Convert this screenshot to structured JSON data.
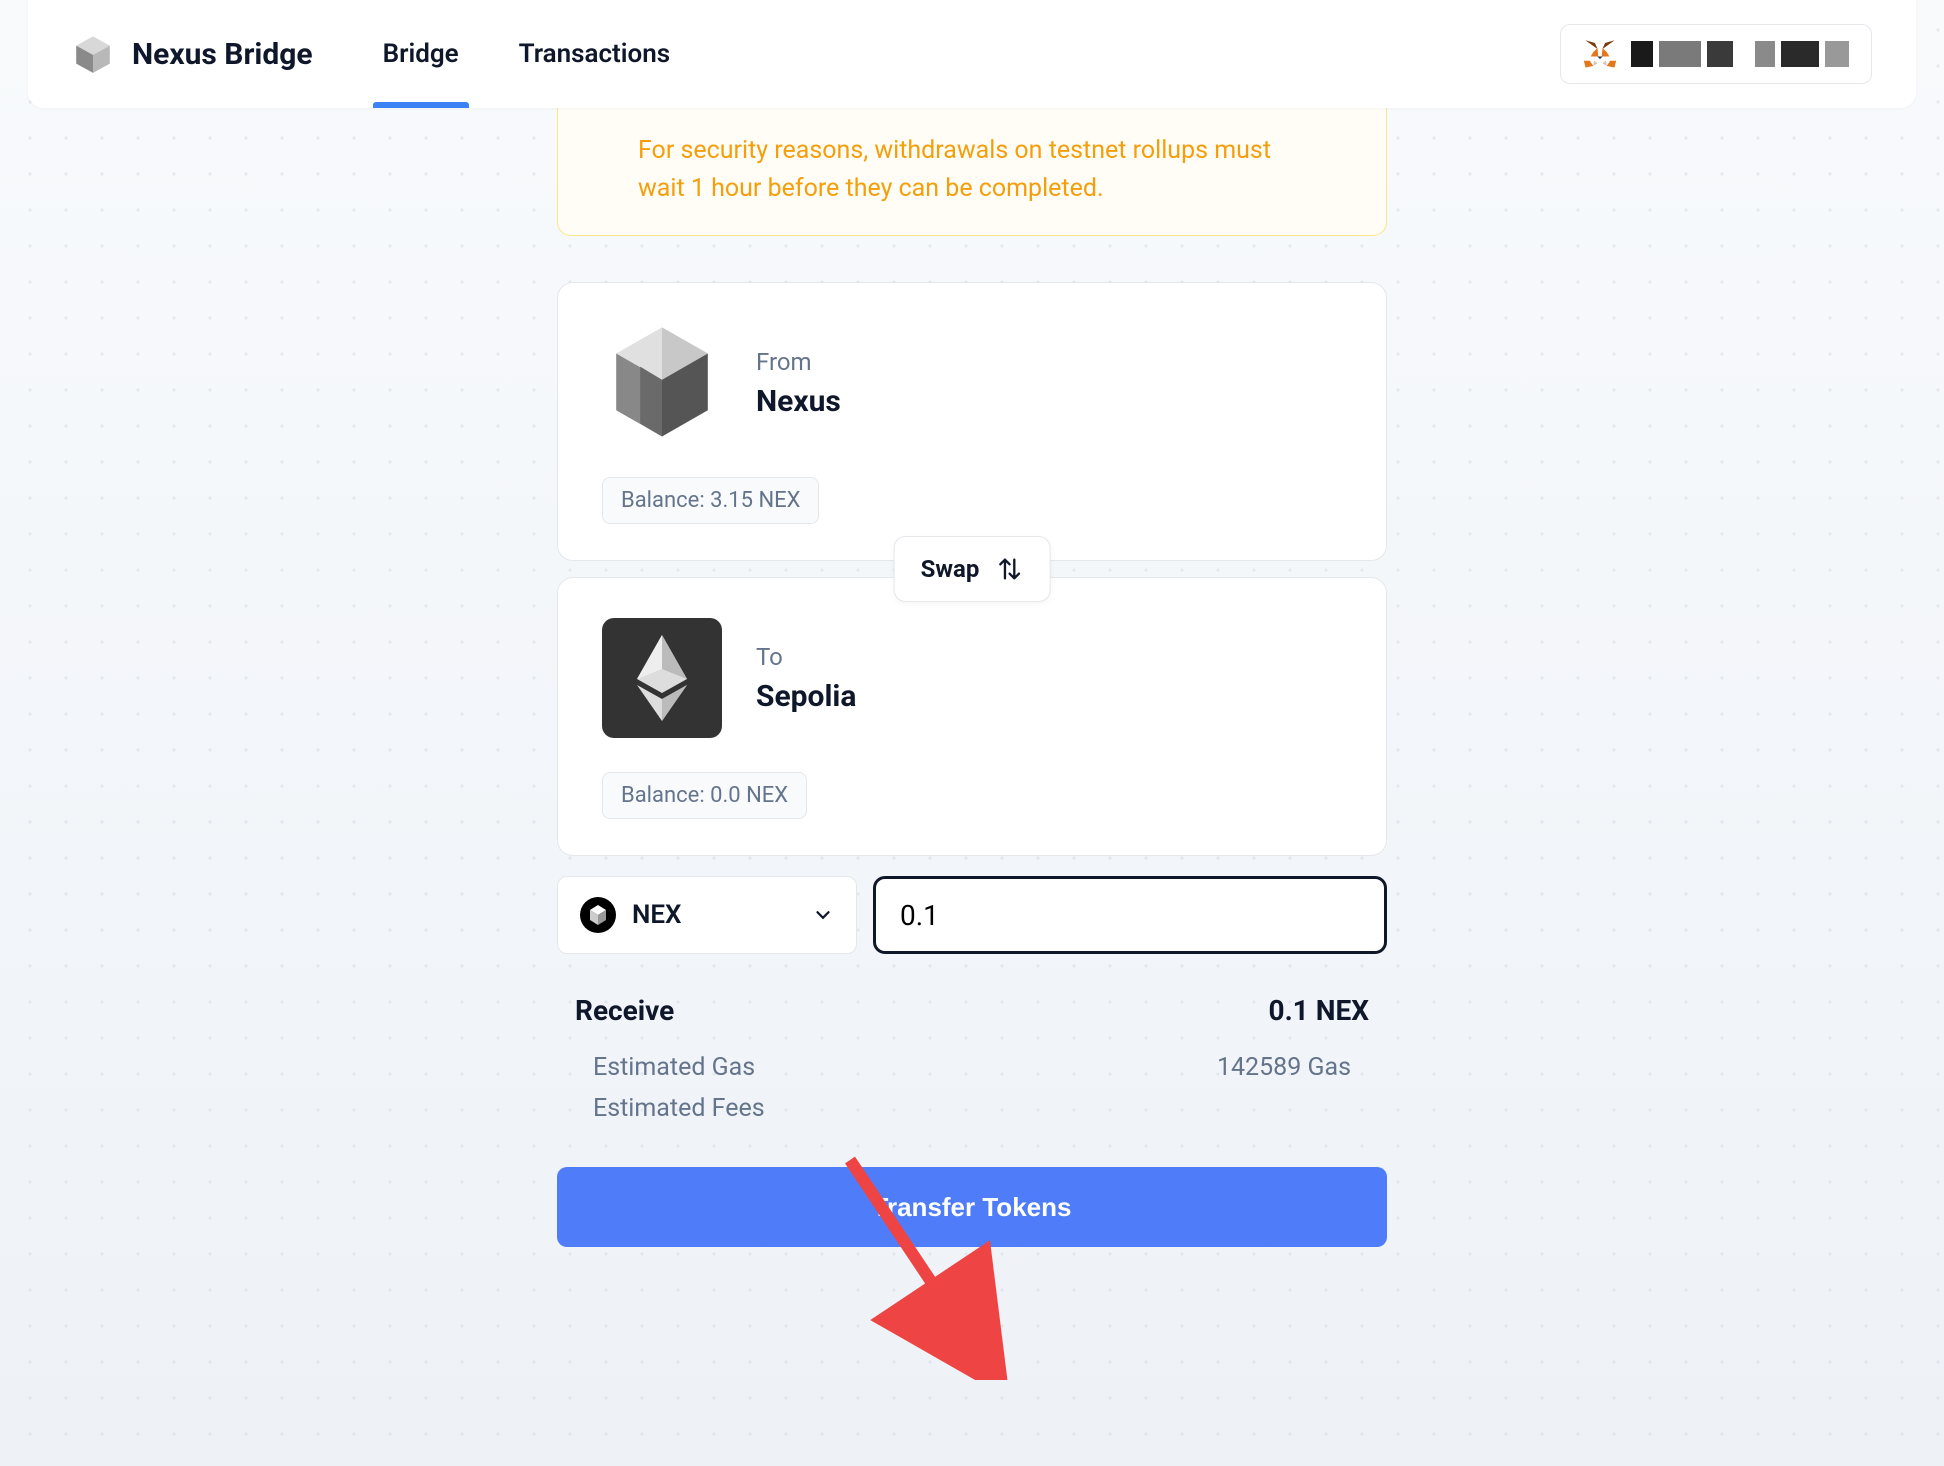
{
  "header": {
    "app_name": "Nexus Bridge",
    "nav": {
      "bridge": "Bridge",
      "transactions": "Transactions"
    }
  },
  "notice": "For security reasons, withdrawals on testnet rollups must wait 1 hour before they can be completed.",
  "from": {
    "label": "From",
    "chain": "Nexus",
    "balance": "Balance: 3.15 NEX"
  },
  "swap_label": "Swap",
  "to": {
    "label": "To",
    "chain": "Sepolia",
    "balance": "Balance: 0.0 NEX"
  },
  "token": {
    "symbol": "NEX"
  },
  "amount_value": "0.1",
  "receive": {
    "label": "Receive",
    "value": "0.1 NEX",
    "gas_label": "Estimated Gas",
    "gas_value": "142589 Gas",
    "fees_label": "Estimated Fees",
    "fees_value": ""
  },
  "transfer_label": "Transfer Tokens"
}
